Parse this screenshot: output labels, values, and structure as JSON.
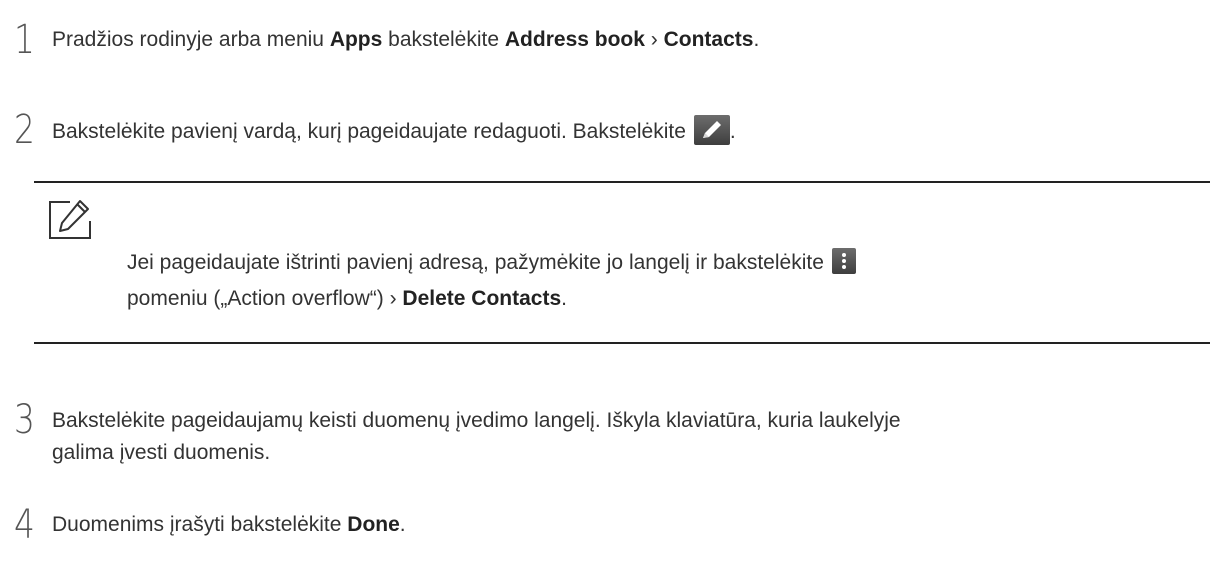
{
  "steps": [
    {
      "number": "1",
      "pre1": "Pradžios rodinyje arba meniu ",
      "b1": "Apps",
      "mid1": " bakstelėkite ",
      "b2": "Address book",
      "sep": " › ",
      "b3": "Contacts",
      "end": "."
    },
    {
      "number": "2",
      "text": "Bakstelėkite pavienį vardą, kurį pageidaujate redaguoti. Bakstelėkite",
      "icon": "pencil-edit-icon",
      "end": "."
    },
    {
      "number": "3",
      "line1": "Bakstelėkite pageidaujamų keisti duomenų įvedimo langelį. Iškyla klaviatūra, kuria laukelyje",
      "line2": "galima įvesti duomenis."
    },
    {
      "number": "4",
      "pre": "Duomenims įrašyti bakstelėkite ",
      "b1": "Done",
      "end": "."
    }
  ],
  "note": {
    "icon": "note-pencil-icon",
    "line1": "Jei pageidaujate ištrinti pavienį adresą, pažymėkite jo langelį ir bakstelėkite",
    "line1_icon": "action-overflow-icon",
    "line2_pre": "pomeniu („Action overflow“) › ",
    "line2_b": "Delete Contacts",
    "line2_end": "."
  },
  "colors": {
    "text": "#333333",
    "rule": "#222222",
    "icon_bg": "#555555",
    "icon_fg": "#ffffff"
  }
}
